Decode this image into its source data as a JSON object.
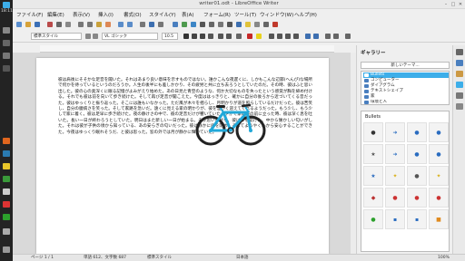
{
  "dock": {
    "time": "18:11"
  },
  "window": {
    "title": "writer01.odt - LibreOffice Writer",
    "min": "–",
    "max": "□",
    "close": "✕"
  },
  "menu": [
    "ファイル(F)",
    "編集(E)",
    "表示(V)",
    "挿入(I)",
    "書式(O)",
    "スタイル(Y)",
    "表(A)",
    "フォーム(R)",
    "ツール(T)",
    "ウィンドウ(W)",
    "ヘルプ(H)"
  ],
  "format": {
    "style": "標準スタイル",
    "font": "VL ゴシック",
    "size": "10.5"
  },
  "document": {
    "body": "彼は肩後にそそかな足音を聞いた。それはあまり良い意味を示すものではない。誰かこんな夜遅くに、しかもこんな辺鄙(へんぴ)な場所で何かを待っているというのだろうか。人生の後半にも差しかかり、その疲労と共に立ち去ろうとしていたのだ。その時、彼はふと思い出した。彼の心の奥深くに眠る記憶がよみがえり始めた。あの日見た青空のような、何か大切なものを失ったという感覚が胸を締め付ける。それでも彼は前を向いて歩き続けた。そして再び足音が聞こえた。今度ははっきりと、確かに自分の後ろから近づいてくる音だった。彼はゆっくりと振り返った。そこには誰もいなかった。ただ風が木々を揺らし、月明かりが道を照らしているだけだった。彼は苦笑し、自分の臆病さを笑った。そして家路を急いだ。遠くに見える家の明かりが、彼を温かく迎えてくれるようだった。もう少し、もう少しで家に着く。彼は足早に歩き続けた。夜の静けさの中で、彼の足音だけが響いていた。やがて家の扉の前に立った時、彼は深く息を吐いた。長い一日が終わろうとしていた。明日はまた新しい一日が始まる。そう思いながら、彼は扉を開けた。中から懐かしい匂いがした。それは彼が子供の頃から知っている、あの安らぎの匂いだった。彼は静かに扉を閉め、そしてようやく心から安心することができた。今夜はゆっくり眠れそうだ、と彼は思った。窓の外では月が静かに輝いていた。"
  },
  "sidebar": {
    "title": "ギャラリー",
    "themes_label": "新しいテーマ...",
    "themes": [
      "Bullets",
      "コンピューター",
      "ダイアグラム",
      "テキストシェイプ",
      "家",
      "環境と人"
    ],
    "selected_theme": "Bullets",
    "bullets_header": "Bullets",
    "bullets": [
      "●",
      "➜",
      "●",
      "●",
      "★",
      "➜",
      "●",
      "●",
      "★",
      "✦",
      "●",
      "✦",
      "◆",
      "●",
      "●",
      "●",
      "●",
      "▪",
      "▪",
      "■"
    ]
  },
  "status": {
    "page": "ページ 1 / 1",
    "words": "単語 612、文字数 687",
    "style": "標準スタイル",
    "lang": "日本語",
    "zoom": "100%"
  },
  "colors": {
    "accent": "#3daee9",
    "bike_frame": "#22a8d8",
    "selection": "#3daee9"
  }
}
